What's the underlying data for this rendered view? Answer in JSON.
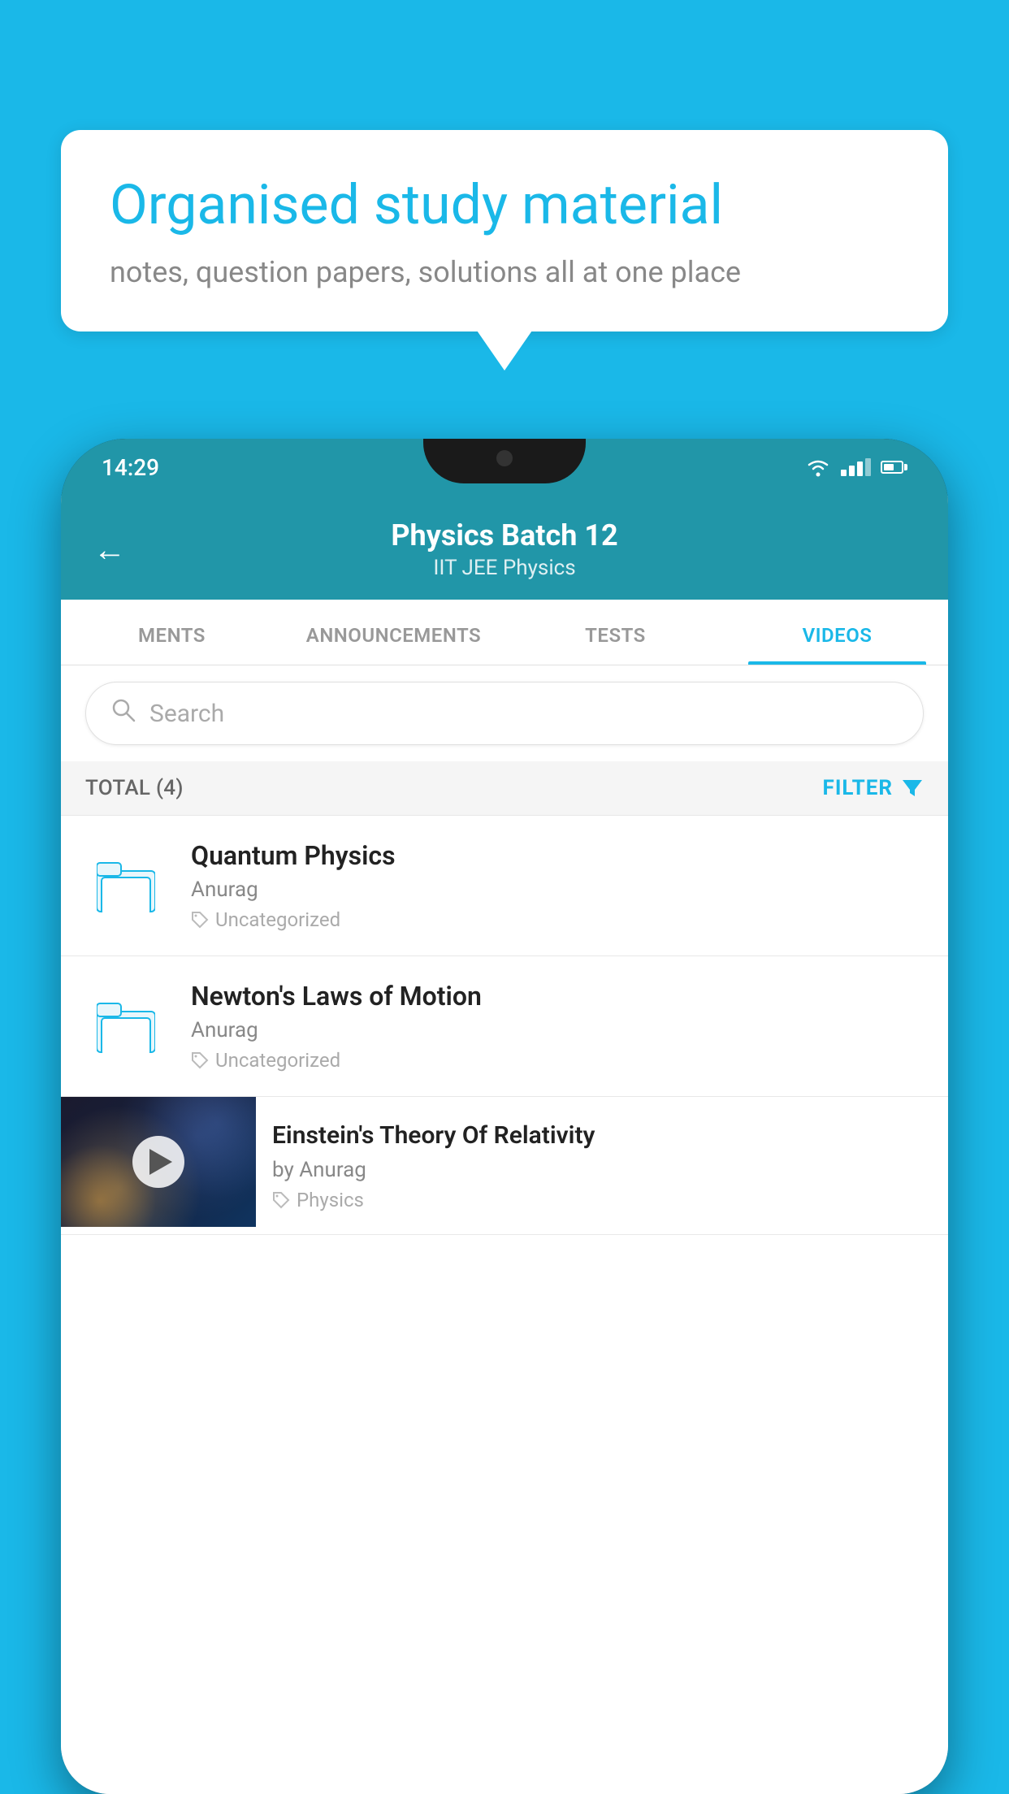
{
  "background_color": "#1ab8e8",
  "speech_bubble": {
    "title": "Organised study material",
    "subtitle": "notes, question papers, solutions all at one place"
  },
  "phone": {
    "status_bar": {
      "time": "14:29"
    },
    "header": {
      "title": "Physics Batch 12",
      "subtitle_tags": "IIT JEE   Physics",
      "back_label": "←"
    },
    "tabs": [
      {
        "label": "MENTS",
        "active": false
      },
      {
        "label": "ANNOUNCEMENTS",
        "active": false
      },
      {
        "label": "TESTS",
        "active": false
      },
      {
        "label": "VIDEOS",
        "active": true
      }
    ],
    "search": {
      "placeholder": "Search"
    },
    "filter_bar": {
      "total_label": "TOTAL (4)",
      "filter_label": "FILTER"
    },
    "videos": [
      {
        "id": 1,
        "title": "Quantum Physics",
        "author": "Anurag",
        "tag": "Uncategorized",
        "type": "folder"
      },
      {
        "id": 2,
        "title": "Newton's Laws of Motion",
        "author": "Anurag",
        "tag": "Uncategorized",
        "type": "folder"
      },
      {
        "id": 3,
        "title": "Einstein's Theory Of Relativity",
        "author": "by Anurag",
        "tag": "Physics",
        "type": "video"
      }
    ]
  }
}
